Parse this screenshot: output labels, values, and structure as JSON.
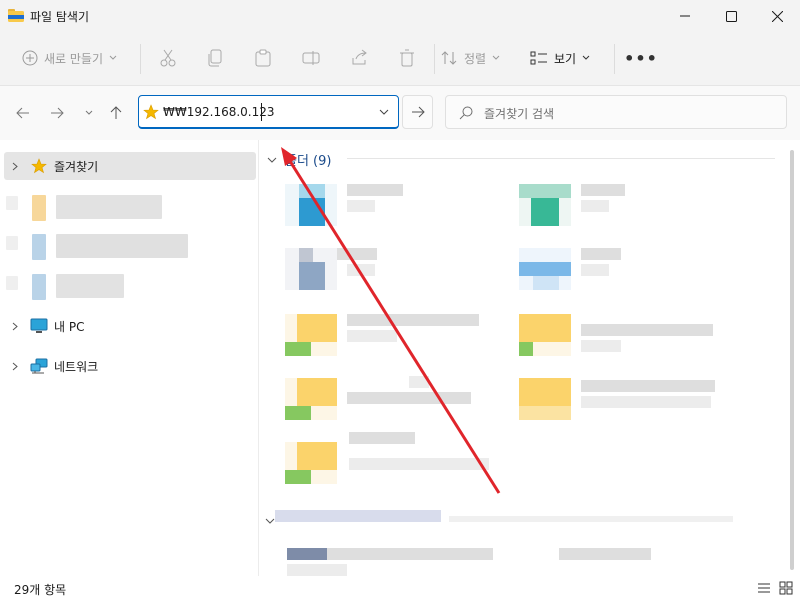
{
  "window": {
    "title": "파일 탐색기"
  },
  "toolbar": {
    "new_label": "새로 만들기",
    "sort_label": "정렬",
    "view_label": "보기",
    "more_label": "•••"
  },
  "address": {
    "path": "₩₩192.168.0.123"
  },
  "search": {
    "placeholder": "즐겨찾기 검색"
  },
  "sidebar": {
    "items": [
      {
        "label": "즐겨찾기",
        "icon": "star-icon"
      },
      {
        "label": "내 PC",
        "icon": "pc-icon"
      },
      {
        "label": "네트워크",
        "icon": "network-icon"
      }
    ]
  },
  "content": {
    "group_label": "폴더 (9)"
  },
  "status": {
    "items_count": "29개 항목"
  },
  "colors": {
    "accent": "#0067c0",
    "annotation_arrow": "#e0252b",
    "folder": "#f8c94a"
  }
}
